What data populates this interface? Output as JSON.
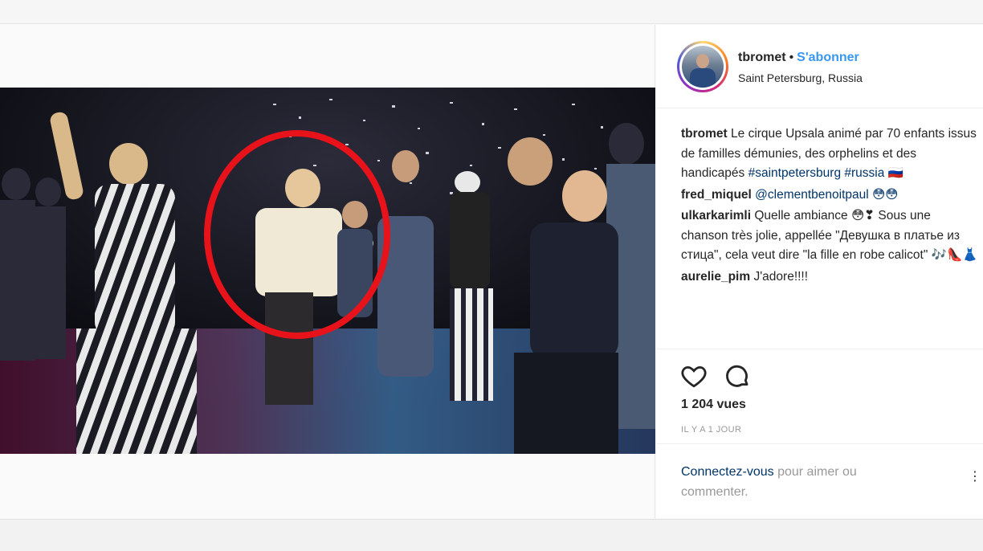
{
  "post": {
    "username": "tbromet",
    "separator": "•",
    "follow_label": "S'abonner",
    "location": "Saint Petersburg, Russia"
  },
  "comments": [
    {
      "user": "tbromet",
      "text": "Le cirque Upsala animé par 70 enfants issus de familles démunies, des orphelins et des handicapés",
      "tags": "#saintpetersburg #russia",
      "suffix": "🇷🇺"
    },
    {
      "user": "fred_miquel",
      "text": "@clementbenoitpaul 😳😳"
    },
    {
      "user": "ulkarkarimli",
      "text": "Quelle ambiance 😳❣ Sous une chanson très jolie, appellée \"Девушка в платье из стица\", cela veut dire \"la fille en robe calicot\" 🎶👠👗"
    },
    {
      "user": "aurelie_pim",
      "text": "J'adore!!!!"
    }
  ],
  "actions": {
    "like_icon": "heart-icon",
    "comment_icon": "comment-icon",
    "views": "1 204 vues",
    "time": "IL Y A 1 JOUR"
  },
  "login": {
    "link": "Connectez-vous",
    "rest": "pour aimer ou commenter.",
    "more": "⋮"
  },
  "colors": {
    "follow_blue": "#3897f0",
    "link_dark_blue": "#003569",
    "highlight_circle": "#e8121b",
    "muted_gray": "#999999"
  }
}
